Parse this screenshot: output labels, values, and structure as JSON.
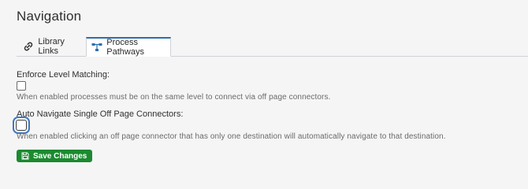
{
  "page": {
    "title": "Navigation"
  },
  "tabs": [
    {
      "label": "Library Links",
      "icon": "link-icon",
      "active": false
    },
    {
      "label": "Process Pathways",
      "icon": "pathway-icon",
      "active": true
    }
  ],
  "settings": [
    {
      "label": "Enforce Level Matching:",
      "checked": false,
      "help": "When enabled processes must be on the same level to connect via off page connectors."
    },
    {
      "label": "Auto Navigate Single Off Page Connectors:",
      "checked": false,
      "focused": true,
      "help": "When enabled clicking an off page connector that has only one destination will automatically navigate to that destination."
    }
  ],
  "actions": {
    "save_label": "Save Changes",
    "save_icon": "floppy-disk-icon"
  },
  "colors": {
    "accent_blue": "#2a6fb0",
    "save_green": "#1b8a2f",
    "background": "#f5f5f6"
  }
}
